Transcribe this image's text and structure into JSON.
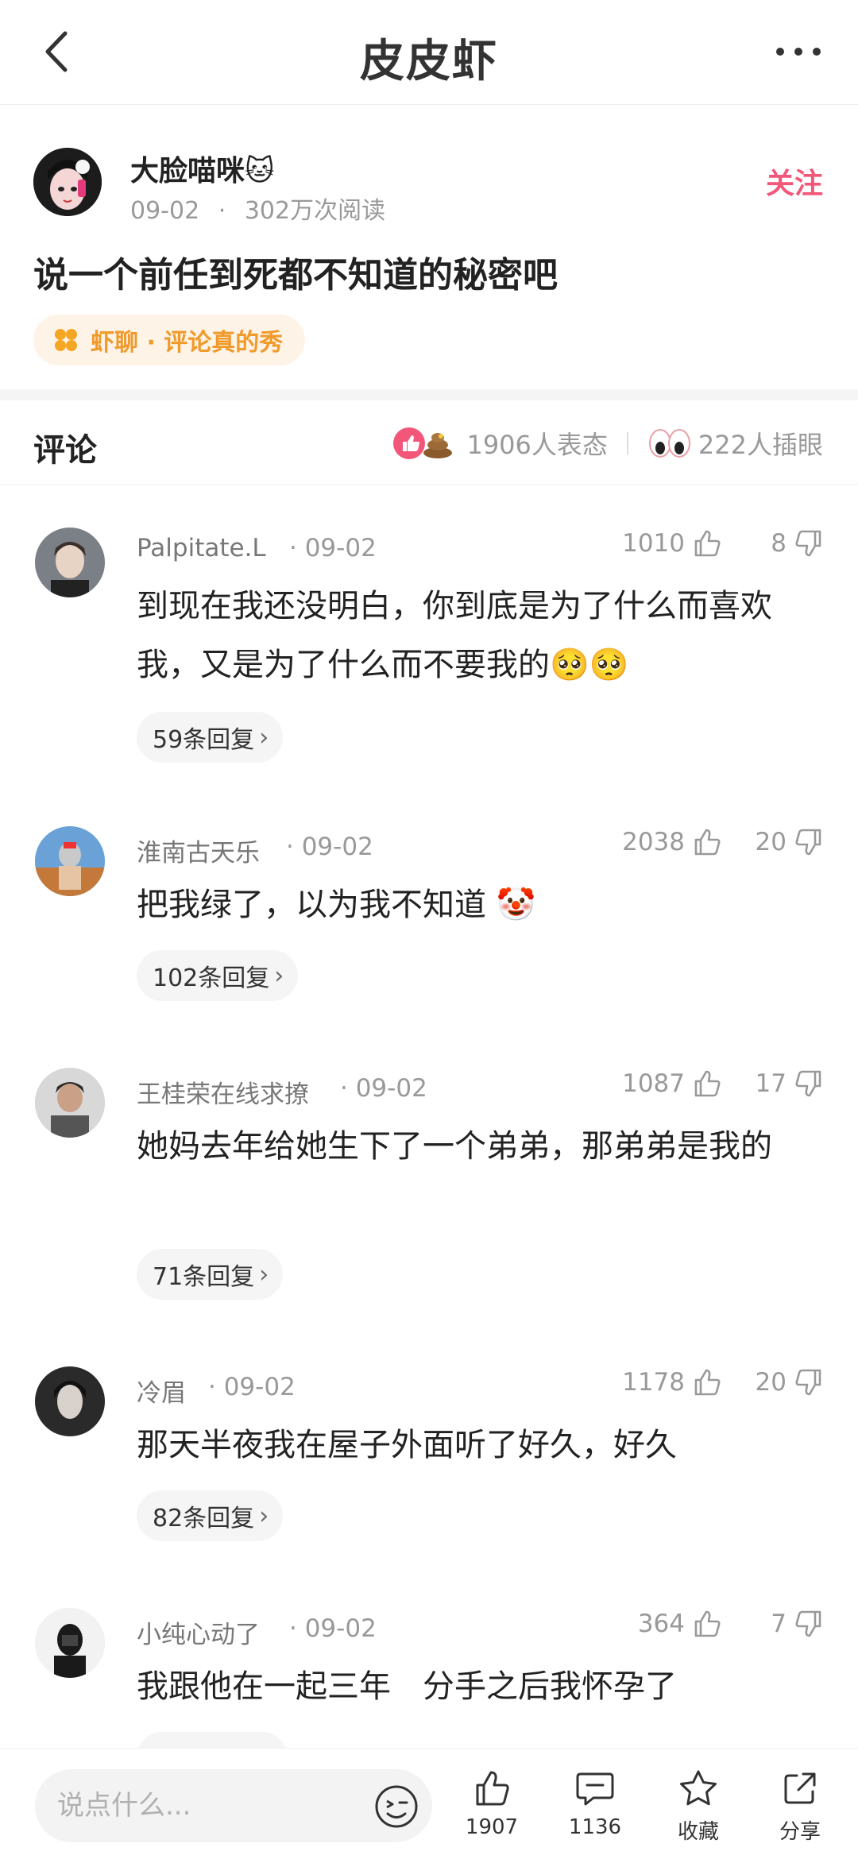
{
  "header": {
    "title": "皮皮虾"
  },
  "post": {
    "author": "大脸喵咪🐱",
    "date": "09-02",
    "dot": "·",
    "views": "302万次阅读",
    "follow_label": "关注",
    "title": "说一个前任到死都不知道的秘密吧",
    "topic": "虾聊 · 评论真的秀"
  },
  "comments_header": {
    "title": "评论",
    "reactions_text": "1906人表态",
    "eyes_text": "222人插眼"
  },
  "comments": [
    {
      "name": "Palpitate.L",
      "date": "· 09-02",
      "likes": "1010",
      "dislikes": "8",
      "text": "到现在我还没明白，你到底是为了什么而喜欢我，又是为了什么而不要我的🥺🥺",
      "replies": "59条回复"
    },
    {
      "name": "淮南古天乐",
      "date": "· 09-02",
      "likes": "2038",
      "dislikes": "20",
      "text": "把我绿了，以为我不知道 🤡",
      "replies": "102条回复"
    },
    {
      "name": "王桂荣在线求撩",
      "date": "· 09-02",
      "likes": "1087",
      "dislikes": "17",
      "text": "她妈去年给她生下了一个弟弟，那弟弟是我的",
      "replies": "71条回复"
    },
    {
      "name": "冷眉",
      "date": "· 09-02",
      "likes": "1178",
      "dislikes": "20",
      "text": "那天半夜我在屋子外面听了好久，好久",
      "replies": "82条回复"
    },
    {
      "name": "小纯心动了",
      "date": "· 09-02",
      "likes": "364",
      "dislikes": "7",
      "text": "我跟他在一起三年　分手之后我怀孕了",
      "replies": ""
    }
  ],
  "bottom_bar": {
    "input_placeholder": "说点什么...",
    "like_count": "1907",
    "comment_count": "1136",
    "favorite_label": "收藏",
    "share_label": "分享"
  },
  "colors": {
    "accent": "#f2577a",
    "topic": "#f09a2b",
    "muted": "#999999"
  }
}
